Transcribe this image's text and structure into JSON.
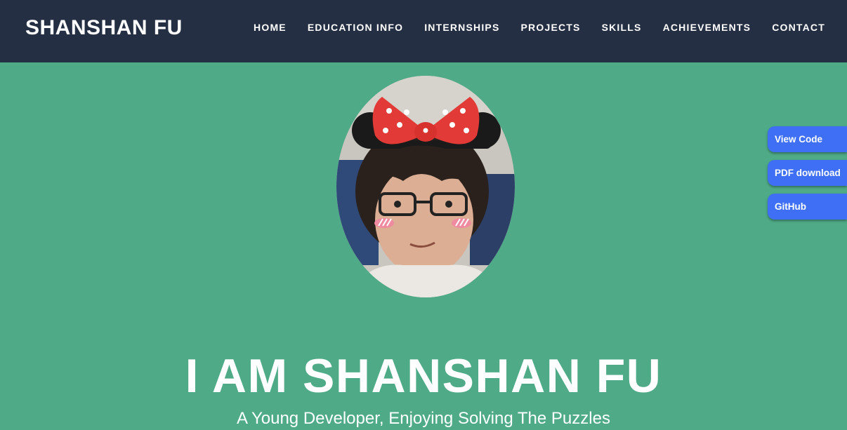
{
  "brand": "SHANSHAN FU",
  "nav": {
    "items": [
      {
        "label": "HOME"
      },
      {
        "label": "EDUCATION INFO"
      },
      {
        "label": "INTERNSHIPS"
      },
      {
        "label": "PROJECTS"
      },
      {
        "label": "SKILLS"
      },
      {
        "label": "ACHIEVEMENTS"
      },
      {
        "label": "CONTACT"
      }
    ]
  },
  "hero": {
    "title": "I AM SHANSHAN FU",
    "subtitle": "A Young Developer, Enjoying Solving The Puzzles"
  },
  "side_buttons": [
    {
      "label": "View Code"
    },
    {
      "label": "PDF download"
    },
    {
      "label": "GitHub"
    }
  ],
  "colors": {
    "navbar_bg": "#242f43",
    "hero_bg": "#4fab87",
    "side_button_bg": "#3f6ff5",
    "text": "#ffffff"
  }
}
